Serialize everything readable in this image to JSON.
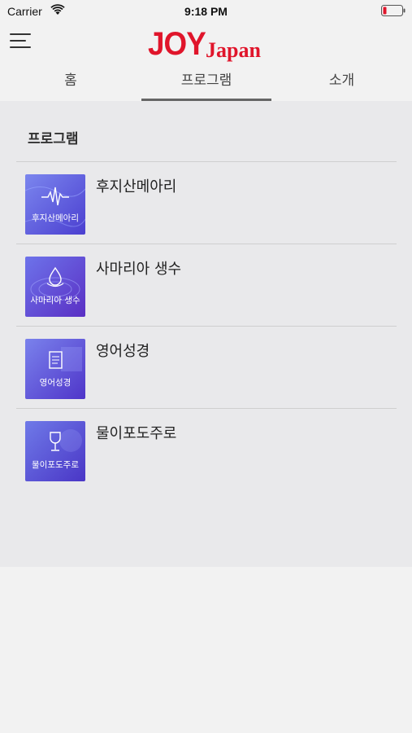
{
  "status_bar": {
    "carrier": "Carrier",
    "time": "9:18 PM",
    "icons": [
      "wifi-icon",
      "battery-icon"
    ],
    "battery_color": "#e0152b"
  },
  "header": {
    "logo_main": "JOY",
    "logo_sub": "Japan",
    "brand_color": "#e0152b",
    "menu_icon": "hamburger-menu-icon"
  },
  "tabs": [
    {
      "label": "홈",
      "active": false
    },
    {
      "label": "프로그램",
      "active": true
    },
    {
      "label": "소개",
      "active": false
    }
  ],
  "main": {
    "section_title": "프로그램",
    "programs": [
      {
        "title": "후지산메아리",
        "thumb_label": "후지산메아리",
        "thumb_icon": "soundwave-icon"
      },
      {
        "title": "사마리아 생수",
        "thumb_label": "사마리아 생수",
        "thumb_icon": "water-drop-icon"
      },
      {
        "title": "영어성경",
        "thumb_label": "영어성경",
        "thumb_icon": "book-icon"
      },
      {
        "title": "물이포도주로",
        "thumb_label": "물이포도주로",
        "thumb_icon": "wine-glass-icon"
      }
    ]
  }
}
